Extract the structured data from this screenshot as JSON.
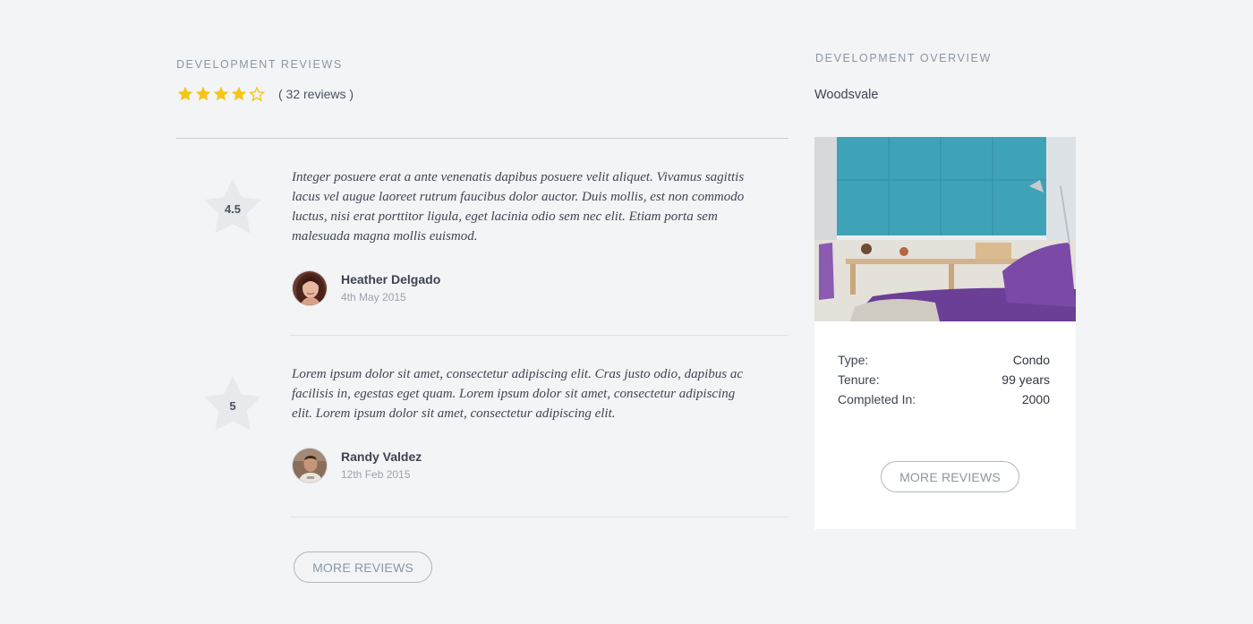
{
  "reviews_section": {
    "title": "DEVELOPMENT REVIEWS",
    "rating": 4,
    "rating_max": 5,
    "review_count_text": "( 32 reviews )",
    "star_color": "#f5c518",
    "items": [
      {
        "score": "4.5",
        "text": "Integer posuere erat a ante venenatis dapibus posuere velit aliquet. Vivamus sagittis lacus vel augue laoreet rutrum faucibus dolor auctor. Duis mollis, est non commodo luctus, nisi erat porttitor ligula, eget lacinia odio sem nec elit. Etiam porta sem malesuada magna mollis euismod.",
        "author": "Heather Delgado",
        "date": "4th May 2015"
      },
      {
        "score": "5",
        "text": "Lorem ipsum dolor sit amet, consectetur adipiscing elit. Cras justo odio, dapibus ac facilisis in, egestas eget quam. Lorem ipsum dolor sit amet, consectetur adipiscing elit. Lorem ipsum dolor sit amet, consectetur adipiscing elit.",
        "author": "Randy Valdez",
        "date": "12th Feb 2015"
      }
    ],
    "more_button": "MORE REVIEWS"
  },
  "overview": {
    "title": "DEVELOPMENT OVERVIEW",
    "name": "Woodsvale",
    "facts": [
      {
        "label": "Type:",
        "value": "Condo"
      },
      {
        "label": "Tenure:",
        "value": "99 years"
      },
      {
        "label": "Completed In:",
        "value": "2000"
      }
    ],
    "more_button": "MORE REVIEWS"
  }
}
